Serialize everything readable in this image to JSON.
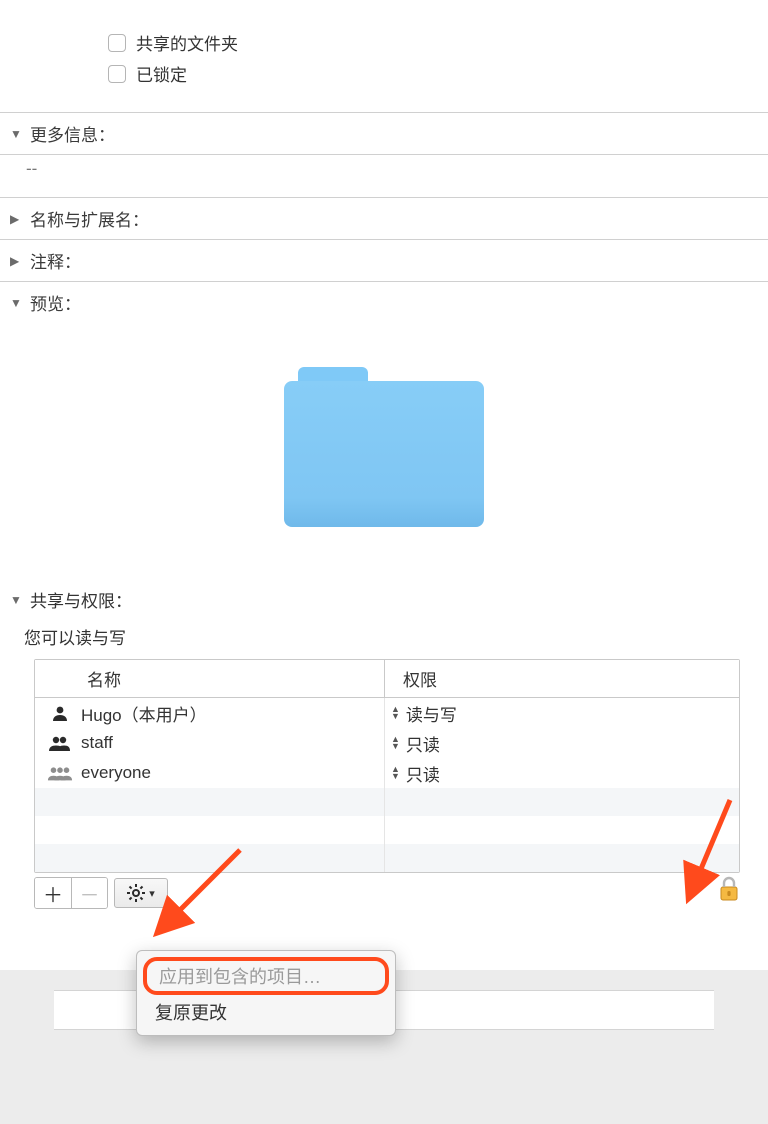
{
  "checkboxes": {
    "shared_folder": "共享的文件夹",
    "locked": "已锁定"
  },
  "sections": {
    "more_info": "更多信息：",
    "more_info_value": "--",
    "name_ext": "名称与扩展名：",
    "comments": "注释：",
    "preview": "预览：",
    "sharing": "共享与权限："
  },
  "sharing": {
    "summary": "您可以读与写",
    "columns": {
      "name": "名称",
      "privilege": "权限"
    },
    "rows": [
      {
        "name": "Hugo（本用户）",
        "priv": "读与写",
        "icon": "single"
      },
      {
        "name": "staff",
        "priv": "只读",
        "icon": "double"
      },
      {
        "name": "everyone",
        "priv": "只读",
        "icon": "group"
      }
    ]
  },
  "menu": {
    "apply_enclosed": "应用到包含的项目…",
    "revert": "复原更改"
  }
}
